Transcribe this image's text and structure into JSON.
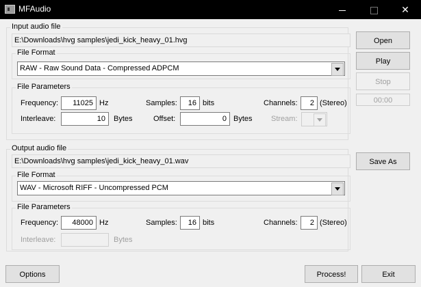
{
  "window": {
    "title": "MFAudio",
    "icon": "app-icon",
    "controls": {
      "minimize": "minimize-icon",
      "maximize": "maximize-icon",
      "close": "✕"
    }
  },
  "input": {
    "group_label": "Input audio file",
    "path": "E:\\Downloads\\hvg samples\\jedi_kick_heavy_01.hvg",
    "format_group_label": "File Format",
    "format_value": "RAW - Raw Sound Data - Compressed ADPCM",
    "params_group_label": "File Parameters",
    "frequency_label": "Frequency:",
    "frequency_value": "11025",
    "frequency_unit": "Hz",
    "samples_label": "Samples:",
    "samples_value": "16",
    "samples_unit": "bits",
    "channels_label": "Channels:",
    "channels_value": "2",
    "channels_note": "(Stereo)",
    "interleave_label": "Interleave:",
    "interleave_value": "10",
    "interleave_unit": "Bytes",
    "offset_label": "Offset:",
    "offset_value": "0",
    "offset_unit": "Bytes",
    "stream_label": "Stream:",
    "stream_value": ""
  },
  "player": {
    "open_label": "Open",
    "play_label": "Play",
    "stop_label": "Stop",
    "time_display": "00:00"
  },
  "output": {
    "group_label": "Output audio file",
    "path": "E:\\Downloads\\hvg samples\\jedi_kick_heavy_01.wav",
    "save_as_label": "Save As",
    "format_group_label": "File Format",
    "format_value": "WAV - Microsoft RIFF - Uncompressed PCM",
    "params_group_label": "File Parameters",
    "frequency_label": "Frequency:",
    "frequency_value": "48000",
    "frequency_unit": "Hz",
    "samples_label": "Samples:",
    "samples_value": "16",
    "samples_unit": "bits",
    "channels_label": "Channels:",
    "channels_value": "2",
    "channels_note": "(Stereo)",
    "interleave_label": "Interleave:",
    "interleave_value": "",
    "interleave_unit": "Bytes"
  },
  "footer": {
    "options_label": "Options",
    "process_label": "Process!",
    "exit_label": "Exit"
  }
}
